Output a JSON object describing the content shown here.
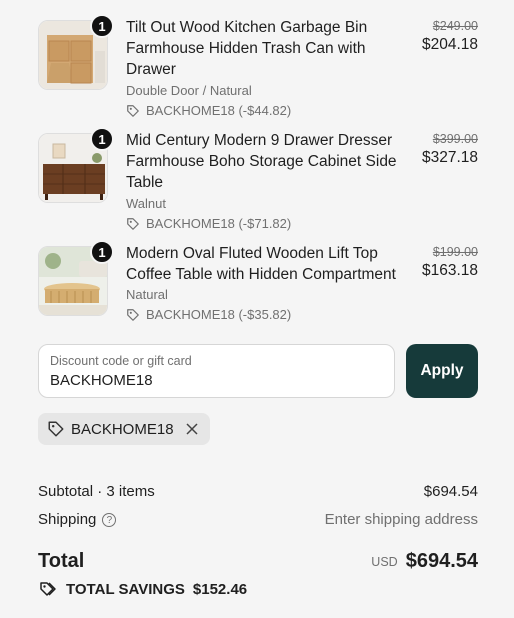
{
  "items": [
    {
      "qty": "1",
      "name": "Tilt Out Wood Kitchen Garbage Bin Farmhouse Hidden Trash Can with Drawer",
      "variant": "Double Door / Natural",
      "discount": "BACKHOME18 (-$44.82)",
      "old_price": "$249.00",
      "price": "$204.18"
    },
    {
      "qty": "1",
      "name": "Mid Century Modern 9 Drawer Dresser Farmhouse Boho Storage Cabinet Side Table",
      "variant": "Walnut",
      "discount": "BACKHOME18 (-$71.82)",
      "old_price": "$399.00",
      "price": "$327.18"
    },
    {
      "qty": "1",
      "name": "Modern Oval Fluted Wooden Lift Top Coffee Table with Hidden Compartment",
      "variant": "Natural",
      "discount": "BACKHOME18 (-$35.82)",
      "old_price": "$199.00",
      "price": "$163.18"
    }
  ],
  "discount_field": {
    "label": "Discount code or gift card",
    "value": "BACKHOME18",
    "apply_label": "Apply"
  },
  "applied_code": "BACKHOME18",
  "summary": {
    "subtotal_label": "Subtotal · 3 items",
    "subtotal_value": "$694.54",
    "shipping_label": "Shipping",
    "shipping_value": "Enter shipping address",
    "total_label": "Total",
    "currency": "USD",
    "total_value": "$694.54",
    "savings_label": "TOTAL SAVINGS",
    "savings_value": "$152.46"
  },
  "colors": {
    "background": "#f5f5f5",
    "apply_button": "#163a3a",
    "muted_text": "#707070",
    "chip_bg": "#e6e6e6"
  },
  "icons": [
    "tag-icon",
    "close-icon",
    "help-circle-icon",
    "tags-icon"
  ]
}
